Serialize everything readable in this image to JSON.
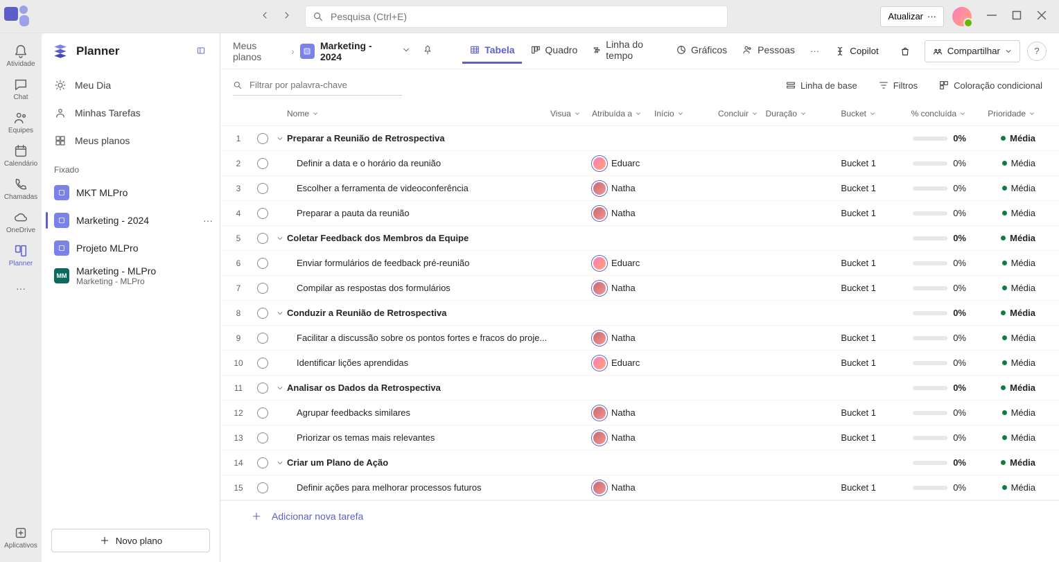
{
  "titlebar": {
    "search_placeholder": "Pesquisa (Ctrl+E)",
    "update_label": "Atualizar"
  },
  "rail": {
    "items": [
      {
        "label": "Atividade"
      },
      {
        "label": "Chat"
      },
      {
        "label": "Equipes"
      },
      {
        "label": "Calendário"
      },
      {
        "label": "Chamadas"
      },
      {
        "label": "OneDrive"
      },
      {
        "label": "Planner",
        "active": true
      }
    ],
    "apps_label": "Aplicativos"
  },
  "sidebar": {
    "title": "Planner",
    "nav": [
      {
        "label": "Meu Dia"
      },
      {
        "label": "Minhas Tarefas"
      },
      {
        "label": "Meus planos"
      }
    ],
    "pinned_label": "Fixado",
    "plans": [
      {
        "name": "MKT MLPro",
        "icon": "p"
      },
      {
        "name": "Marketing - 2024",
        "icon": "p",
        "active": true
      },
      {
        "name": "Projeto MLPro",
        "icon": "p"
      },
      {
        "name": "Marketing - MLPro",
        "sub": "Marketing - MLPro",
        "icon": "g"
      }
    ],
    "new_plan_label": "Novo plano"
  },
  "crumbs": {
    "root": "Meus planos",
    "current": "Marketing - 2024"
  },
  "views": [
    {
      "label": "Tabela",
      "active": true
    },
    {
      "label": "Quadro"
    },
    {
      "label": "Linha do tempo"
    },
    {
      "label": "Gráficos"
    },
    {
      "label": "Pessoas"
    }
  ],
  "actions": {
    "copilot": "Copilot",
    "share": "Compartilhar"
  },
  "toolbar": {
    "filter_placeholder": "Filtrar por palavra-chave",
    "baseline": "Linha de base",
    "filters": "Filtros",
    "coloring": "Coloração condicional"
  },
  "columns": {
    "name": "Nome",
    "visu": "Visua",
    "assigned": "Atribuída a",
    "start": "Início",
    "end": "Concluir",
    "duration": "Duração",
    "bucket": "Bucket",
    "pct": "% concluída",
    "priority": "Prioridade"
  },
  "rows": [
    {
      "n": 1,
      "parent": true,
      "name": "Preparar a Reunião de Retrospectiva",
      "pct": "0%",
      "priority": "Média"
    },
    {
      "n": 2,
      "name": "Definir a data e o horário da reunião",
      "assignee": "Eduarc",
      "av": "e",
      "bucket": "Bucket 1",
      "pct": "0%",
      "priority": "Média"
    },
    {
      "n": 3,
      "name": "Escolher a ferramenta de videoconferência",
      "assignee": "Natha",
      "av": "n",
      "bucket": "Bucket 1",
      "pct": "0%",
      "priority": "Média"
    },
    {
      "n": 4,
      "name": "Preparar a pauta da reunião",
      "assignee": "Natha",
      "av": "n",
      "bucket": "Bucket 1",
      "pct": "0%",
      "priority": "Média"
    },
    {
      "n": 5,
      "parent": true,
      "name": "Coletar Feedback dos Membros da Equipe",
      "pct": "0%",
      "priority": "Média"
    },
    {
      "n": 6,
      "name": "Enviar formulários de feedback pré-reunião",
      "assignee": "Eduarc",
      "av": "e",
      "bucket": "Bucket 1",
      "pct": "0%",
      "priority": "Média"
    },
    {
      "n": 7,
      "name": "Compilar as respostas dos formulários",
      "assignee": "Natha",
      "av": "n",
      "bucket": "Bucket 1",
      "pct": "0%",
      "priority": "Média"
    },
    {
      "n": 8,
      "parent": true,
      "name": "Conduzir a Reunião de Retrospectiva",
      "pct": "0%",
      "priority": "Média"
    },
    {
      "n": 9,
      "name": "Facilitar a discussão sobre os pontos fortes e fracos do proje...",
      "assignee": "Natha",
      "av": "n",
      "bucket": "Bucket 1",
      "pct": "0%",
      "priority": "Média"
    },
    {
      "n": 10,
      "name": "Identificar lições aprendidas",
      "assignee": "Eduarc",
      "av": "e",
      "bucket": "Bucket 1",
      "pct": "0%",
      "priority": "Média"
    },
    {
      "n": 11,
      "parent": true,
      "name": "Analisar os Dados da Retrospectiva",
      "pct": "0%",
      "priority": "Média"
    },
    {
      "n": 12,
      "name": "Agrupar feedbacks similares",
      "assignee": "Natha",
      "av": "n",
      "bucket": "Bucket 1",
      "pct": "0%",
      "priority": "Média"
    },
    {
      "n": 13,
      "name": "Priorizar os temas mais relevantes",
      "assignee": "Natha",
      "av": "n",
      "bucket": "Bucket 1",
      "pct": "0%",
      "priority": "Média"
    },
    {
      "n": 14,
      "parent": true,
      "name": "Criar um Plano de Ação",
      "pct": "0%",
      "priority": "Média"
    },
    {
      "n": 15,
      "name": "Definir ações para melhorar processos futuros",
      "assignee": "Natha",
      "av": "n",
      "bucket": "Bucket 1",
      "pct": "0%",
      "priority": "Média"
    }
  ],
  "add_task": "Adicionar nova tarefa"
}
